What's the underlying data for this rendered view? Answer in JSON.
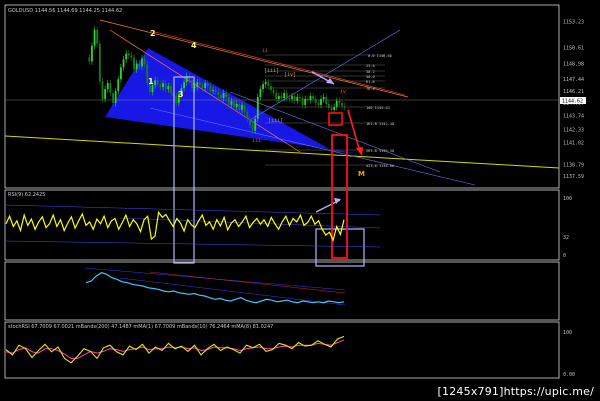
{
  "colors": {
    "background": "#000000",
    "candle_up": "#2fd12f",
    "candle_down": "#1c7a1c",
    "wedge_fill": "#1a1aff",
    "rsi_line": "#ffff00",
    "macd_line": "#3fc6ff",
    "stoch_main": "#e8e800",
    "stoch_signal": "#ff3fc8",
    "trend_orange": "#ff7a28",
    "trend_yellow": "#d8d800",
    "trend_blue": "#6688ff",
    "box_lavender": "#b4b8ff",
    "box_red": "#ff1010",
    "arrow_red": "#ff2020",
    "arrow_lavender": "#c0a8ff"
  },
  "panels": {
    "main": {
      "header": "GOLDUSD 1144.56 1144.69 1144.25 1144.62",
      "price_label": "1144.62"
    },
    "rsi": {
      "header": "RSI(9) 62.2425"
    },
    "stoch": {
      "header": "stochRSI 67.7009 67.0021 mBands(200) 47.1487 mMA(1) 67.7009 mBands(10) 76.2464 mMA(8) 81.0247"
    }
  },
  "wave_labels": [
    {
      "text": "1",
      "color": "#ffffff"
    },
    {
      "text": "2",
      "color": "#ffff66"
    },
    {
      "text": "3",
      "color": "#ffff66"
    },
    {
      "text": "4",
      "color": "#ffff66"
    },
    {
      "text": "[iii]",
      "color": "#d8a000"
    },
    {
      "text": "[iii]",
      "color": "#d8a000"
    },
    {
      "text": "[iv]",
      "color": "#d8a000"
    },
    {
      "text": "ii",
      "color": "#ff4040"
    },
    {
      "text": "iii",
      "color": "#ff4040"
    },
    {
      "text": "iv",
      "color": "#ff4040"
    },
    {
      "text": "M",
      "color": "#ff9a00"
    }
  ],
  "fib_levels": [
    "0.0 1146.66",
    "23.6",
    "38.2",
    "50.0",
    "61.8",
    "76.4",
    "100 1144.63",
    "161.8 1142.48",
    "261.8 1139.30",
    "423.6 1136.60"
  ],
  "watermark": "[1245x791]https://upic.me/",
  "chart_data": [
    {
      "type": "candlestick",
      "name": "GOLDUSD",
      "y_ticks": [
        "1153.23",
        "1150.61",
        "1148.98",
        "1147.44",
        "1146.21",
        "1144.97",
        "1143.74",
        "1142.33",
        "1141.02",
        "1138.79",
        "1137.59"
      ],
      "ylim": [
        1137.0,
        1154.0
      ],
      "close": [
        1149.2,
        1150.8,
        1152.4,
        1151.0,
        1147.2,
        1145.4,
        1146.4,
        1147.0,
        1146.0,
        1145.0,
        1146.2,
        1147.4,
        1148.6,
        1149.4,
        1150.0,
        1149.8,
        1149.6,
        1148.4,
        1149.0,
        1148.7,
        1149.5,
        1148.9,
        1147.0,
        1146.1,
        1146.8,
        1147.3,
        1146.9,
        1146.6,
        1147.0,
        1146.4,
        1146.7,
        1146.0,
        1145.7,
        1145.0,
        1145.9,
        1146.5,
        1147.1,
        1147.7,
        1147.3,
        1146.5,
        1146.6,
        1147.1,
        1146.8,
        1146.5,
        1147.0,
        1146.7,
        1146.2,
        1146.3,
        1146.1,
        1145.8,
        1145.5,
        1146.0,
        1145.6,
        1144.8,
        1145.2,
        1144.6,
        1144.9,
        1144.3,
        1144.8,
        1144.1,
        1143.4,
        1142.8,
        1142.2,
        1143.4,
        1145.6,
        1146.4,
        1146.9,
        1147.1,
        1146.7,
        1146.3,
        1146.0,
        1145.4,
        1145.7,
        1145.5,
        1146.0,
        1145.5,
        1145.4,
        1145.7,
        1145.2,
        1145.6,
        1145.5,
        1144.8,
        1145.4,
        1145.3,
        1145.7,
        1145.4,
        1145.0,
        1144.8,
        1145.4,
        1145.6,
        1144.9,
        1144.5,
        1144.3,
        1144.6,
        1145.2,
        1145.0,
        1144.7,
        1144.6
      ]
    },
    {
      "type": "line",
      "name": "RSI(9)",
      "ylim": [
        0,
        100
      ],
      "y_ticks": [
        "100",
        "32",
        "0"
      ],
      "values": [
        55,
        68,
        50,
        60,
        43,
        70,
        52,
        63,
        45,
        58,
        67,
        48,
        55,
        70,
        50,
        62,
        43,
        56,
        67,
        47,
        60,
        72,
        52,
        58,
        45,
        63,
        55,
        68,
        48,
        60,
        64,
        45,
        57,
        70,
        50,
        62,
        55,
        41,
        62,
        68,
        28,
        33,
        75,
        66,
        71,
        60,
        50,
        64,
        56,
        42,
        62,
        53,
        48,
        60,
        70,
        52,
        58,
        45,
        62,
        51,
        66,
        44,
        56,
        62,
        50,
        58,
        68,
        48,
        57,
        64,
        54,
        62,
        50,
        66,
        55,
        45,
        58,
        68,
        52,
        64,
        58,
        70,
        52,
        57,
        68,
        54,
        60,
        45,
        35,
        40,
        26,
        50,
        36,
        62
      ]
    },
    {
      "type": "line",
      "name": "MACD",
      "values": [
        40,
        42,
        48,
        52,
        50,
        46,
        44,
        41,
        40,
        38,
        37,
        36,
        34,
        33,
        32,
        30,
        29,
        30,
        28,
        27,
        26,
        27,
        25,
        24,
        22,
        20,
        21,
        19,
        18,
        20,
        22,
        19,
        17,
        16,
        18,
        20,
        19,
        17,
        18,
        19,
        17,
        16,
        18,
        17,
        16,
        17,
        16,
        18,
        17,
        16,
        17
      ]
    },
    {
      "type": "line",
      "name": "stochRSI",
      "ylim": [
        0,
        100
      ],
      "y_ticks": [
        "100",
        "0.00"
      ],
      "series": [
        {
          "name": "main",
          "values": [
            60,
            48,
            70,
            62,
            42,
            58,
            72,
            55,
            66,
            40,
            30,
            45,
            62,
            56,
            40,
            64,
            70,
            55,
            48,
            68,
            60,
            72,
            52,
            66,
            58,
            74,
            62,
            68,
            56,
            70,
            48,
            62,
            72,
            58,
            66,
            60,
            52,
            70,
            64,
            72,
            56,
            60,
            74,
            70,
            62,
            76,
            68,
            70,
            80,
            72,
            66,
            84,
            90
          ]
        },
        {
          "name": "signal",
          "values": [
            55,
            52,
            60,
            64,
            55,
            52,
            62,
            62,
            58,
            50,
            40,
            40,
            48,
            56,
            52,
            56,
            62,
            60,
            56,
            60,
            62,
            66,
            60,
            62,
            62,
            66,
            64,
            66,
            62,
            64,
            58,
            60,
            66,
            64,
            64,
            62,
            58,
            62,
            64,
            66,
            62,
            62,
            66,
            68,
            66,
            70,
            70,
            70,
            74,
            72,
            70,
            76,
            82
          ]
        }
      ]
    }
  ]
}
